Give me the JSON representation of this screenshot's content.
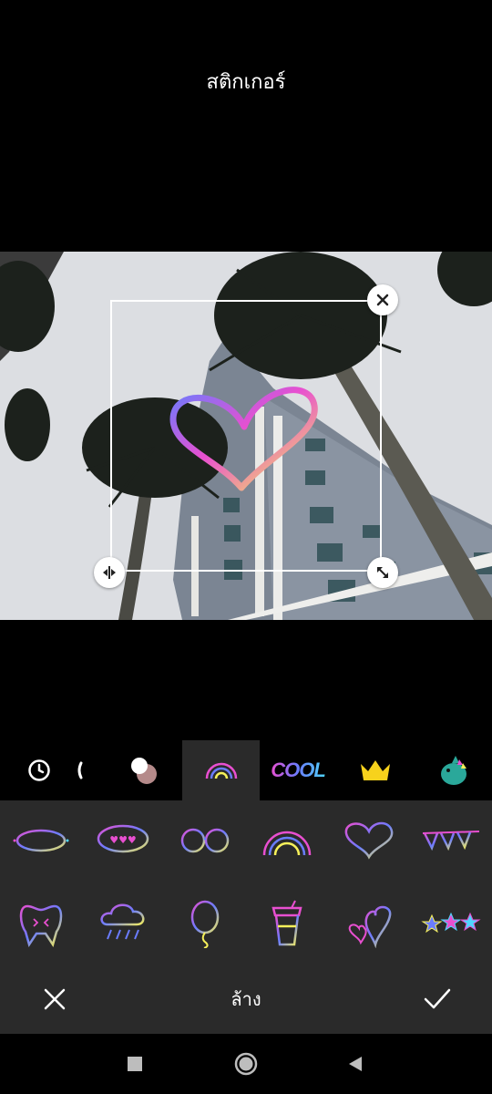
{
  "header": {
    "title": "สติกเกอร์"
  },
  "sticker_box": {
    "close_icon": "close-icon",
    "flip_icon": "flip-horizontal-icon",
    "resize_icon": "resize-icon"
  },
  "tabs": [
    {
      "name": "recent",
      "icon": "clock-icon"
    },
    {
      "name": "partial",
      "icon": "partial-icon"
    },
    {
      "name": "blobs",
      "icon": "color-blobs-icon"
    },
    {
      "name": "rainbow",
      "icon": "rainbow-icon",
      "active": true
    },
    {
      "name": "cool",
      "label": "COOL"
    },
    {
      "name": "crown",
      "icon": "crown-icon"
    },
    {
      "name": "dino",
      "icon": "dinosaur-icon"
    }
  ],
  "stickers_row1": [
    "ellipse-sparkle",
    "heart-speech-bubble",
    "glasses",
    "rainbow",
    "heart",
    "bunting-flags"
  ],
  "stickers_row2": [
    "tooth",
    "rain-cloud",
    "balloon",
    "coffee-cup",
    "hearts",
    "stars"
  ],
  "actions": {
    "cancel_icon": "close-icon",
    "clear_label": "ล้าง",
    "confirm_icon": "check-icon"
  },
  "colors": {
    "background": "#000000",
    "panel": "#2a2a2a",
    "gradient": [
      "#e84fd0",
      "#6a7cff",
      "#4fd6ff",
      "#f6f05a"
    ]
  }
}
